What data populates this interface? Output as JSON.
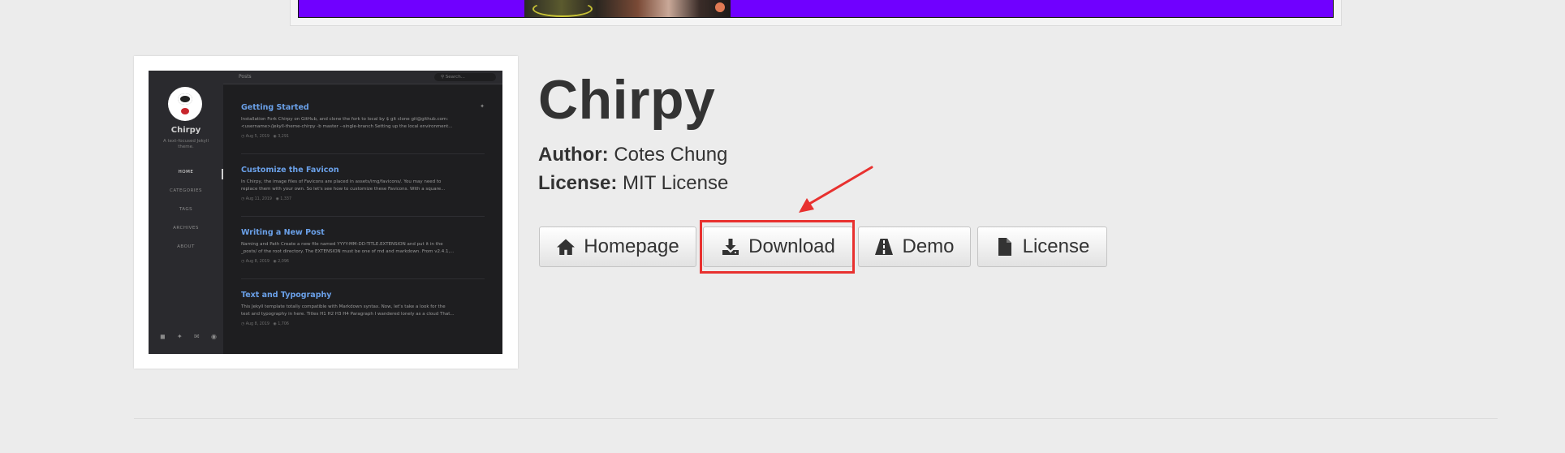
{
  "theme": {
    "name": "Chirpy",
    "author_label": "Author:",
    "author": "Cotes Chung",
    "license_label": "License:",
    "license": "MIT License"
  },
  "buttons": {
    "homepage": "Homepage",
    "download": "Download",
    "demo": "Demo",
    "license": "License"
  },
  "icons": {
    "homepage": "home-icon",
    "download": "download-icon",
    "demo": "road-icon",
    "license": "file-icon"
  },
  "colors": {
    "banner": "#7000ff",
    "highlight": "#e8312f",
    "page_bg": "#ececec"
  },
  "preview": {
    "brand": "Chirpy",
    "tagline": "A text-focused Jekyll theme.",
    "topbar_title": "Posts",
    "search_placeholder": "Search...",
    "nav": [
      "HOME",
      "CATEGORIES",
      "TAGS",
      "ARCHIVES",
      "ABOUT"
    ],
    "posts": [
      {
        "title": "Getting Started",
        "line1": "Installation Fork Chirpy on GitHub, and clone the fork to local by $ git clone git@github.com:",
        "line2": "<username>/jekyll-theme-chirpy -b master --single-branch Setting up the local environment...",
        "date": "Aug 5, 2019",
        "views": "3,291"
      },
      {
        "title": "Customize the Favicon",
        "line1": "In Chirpy, the image files of Favicons are placed in assets/img/favicons/. You may need to",
        "line2": "replace them with your own. So let's see how to customize these Favicons. With a square...",
        "date": "Aug 11, 2019",
        "views": "1,337"
      },
      {
        "title": "Writing a New Post",
        "line1": "Naming and Path Create a new file named YYYY-MM-DD-TITLE.EXTENSION and put it in the",
        "line2": "_posts/ of the root directory. The EXTENSION must be one of md and markdown. From v2.4.1,...",
        "date": "Aug 8, 2019",
        "views": "2,096"
      },
      {
        "title": "Text and Typography",
        "line1": "This Jekyll template totally compatible with Markdown syntax. Now, let's take a look for the",
        "line2": "text and typography in here. Titles H1 H2 H3 H4 Paragraph I wandered lonely as a cloud That...",
        "date": "Aug 8, 2019",
        "views": "1,706"
      }
    ]
  }
}
